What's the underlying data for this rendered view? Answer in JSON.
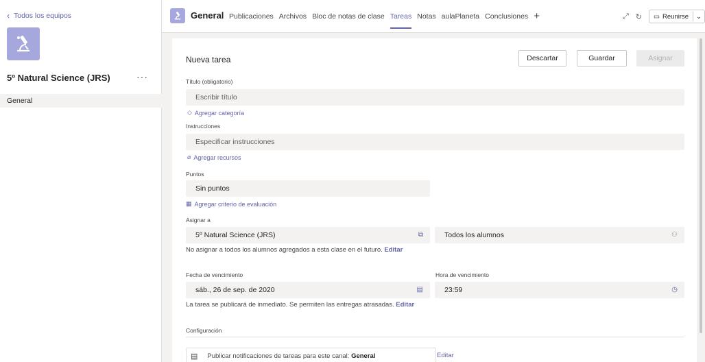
{
  "sidebar": {
    "back_label": "Todos los equipos",
    "team_name": "5º Natural Science (JRS)",
    "more_label": "···",
    "channel": "General"
  },
  "topbar": {
    "channel_title": "General",
    "tabs": [
      {
        "label": "Publicaciones",
        "active": false
      },
      {
        "label": "Archivos",
        "active": false
      },
      {
        "label": "Bloc de notas de clase",
        "active": false
      },
      {
        "label": "Tareas",
        "active": true
      },
      {
        "label": "Notas",
        "active": false
      },
      {
        "label": "aulaPlaneta",
        "active": false
      },
      {
        "label": "Conclusiones",
        "active": false
      }
    ],
    "add_tab": "+",
    "meet_label": "Reunirse"
  },
  "form": {
    "title": "Nueva tarea",
    "discard_label": "Descartar",
    "save_label": "Guardar",
    "assign_label": "Asignar",
    "title_label": "Título (obligatorio)",
    "title_placeholder": "Escribir título",
    "add_category": "Agregar categoría",
    "instructions_label": "Instrucciones",
    "instructions_placeholder": "Especificar instrucciones",
    "add_resources": "Agregar recursos",
    "points_label": "Puntos",
    "points_value": "Sin puntos",
    "add_rubric": "Agregar criterio de evaluación",
    "assign_to_label": "Asignar a",
    "assign_class": "5º Natural Science (JRS)",
    "assign_students": "Todos los alumnos",
    "assign_note": "No asignar a todos los alumnos agregados a esta clase en el futuro.",
    "edit_label": "Editar",
    "due_date_label": "Fecha de vencimiento",
    "due_date": "sáb., 26 de sep. de 2020",
    "due_time_label": "Hora de vencimiento",
    "due_time": "23:59",
    "publish_note": "La tarea se publicará de inmediato. Se permiten las entregas atrasadas.",
    "config_label": "Configuración",
    "notify_text": "Publicar notificaciones de tareas para este canal:",
    "notify_channel": "General",
    "config_edit": "Editar"
  },
  "colors": {
    "accent": "#6264a7",
    "avatar_bg": "#a6a7dc",
    "field_bg": "#f3f2f1"
  }
}
